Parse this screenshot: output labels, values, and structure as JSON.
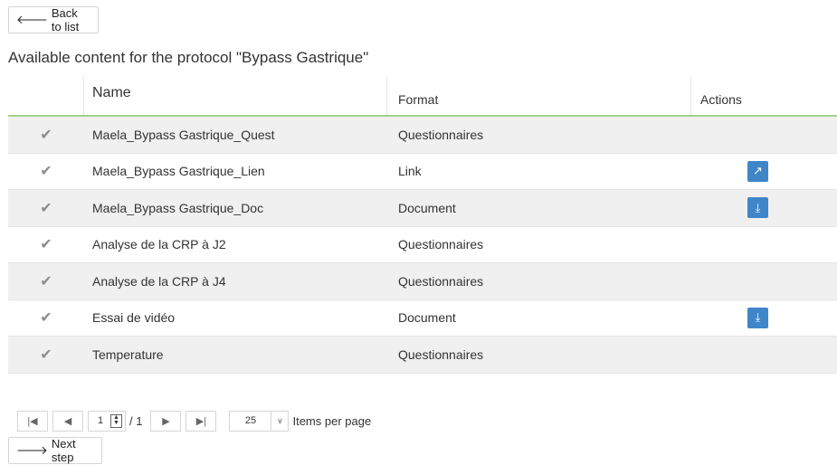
{
  "nav": {
    "back_label": "Back to list",
    "next_label": "Next step"
  },
  "title": "Available content for the protocol \"Bypass Gastrique\"",
  "table": {
    "headers": {
      "name": "Name",
      "format": "Format",
      "actions": "Actions"
    },
    "rows": [
      {
        "name": "Maela_Bypass Gastrique_Quest",
        "format": "Questionnaires",
        "action": ""
      },
      {
        "name": "Maela_Bypass Gastrique_Lien",
        "format": "Link",
        "action": "external-link-icon"
      },
      {
        "name": "Maela_Bypass Gastrique_Doc",
        "format": "Document",
        "action": "download-icon"
      },
      {
        "name": "Analyse de la CRP à J2",
        "format": "Questionnaires",
        "action": ""
      },
      {
        "name": "Analyse de la CRP à J4",
        "format": "Questionnaires",
        "action": ""
      },
      {
        "name": "Essai de vidéo",
        "format": "Document",
        "action": "download-icon"
      },
      {
        "name": "Temperature",
        "format": "Questionnaires",
        "action": ""
      }
    ]
  },
  "pager": {
    "page": "1",
    "total": "/ 1",
    "page_size": "25",
    "items_label": "Items per page"
  },
  "colors": {
    "accent": "#3f86c8",
    "header_underline": "#9fd38b",
    "alt_row": "#f0f0f0"
  }
}
